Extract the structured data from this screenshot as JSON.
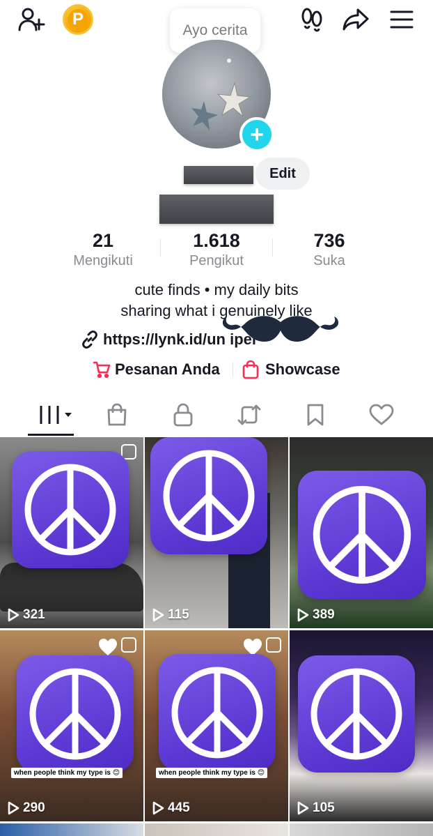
{
  "header": {
    "coin_letter": "P",
    "story_bubble": "Ayo cerita"
  },
  "profile": {
    "edit_label": "Edit"
  },
  "stats": [
    {
      "value": "21",
      "label": "Mengikuti"
    },
    {
      "value": "1.618",
      "label": "Pengikut"
    },
    {
      "value": "736",
      "label": "Suka"
    }
  ],
  "bio": {
    "line1": "cute finds • my daily bits",
    "line2": "sharing what i genuinely like",
    "link": "https://lynk.id/un          iper"
  },
  "shop": {
    "orders_label": "Pesanan Anda",
    "showcase_label": "Showcase",
    "accent": "#fe2c55"
  },
  "tabs": [
    "videos-icon",
    "shop-bag-icon",
    "lock-icon",
    "repost-icon",
    "bookmark-icon",
    "heart-icon"
  ],
  "videos": [
    {
      "views": "321"
    },
    {
      "views": "115"
    },
    {
      "views": "389"
    },
    {
      "views": "290",
      "caption": "when people think my type is 😊"
    },
    {
      "views": "445",
      "caption": "when people think my type is 😊"
    },
    {
      "views": "105"
    }
  ],
  "colors": {
    "peace_tile": "#5b37d2",
    "plus_badge": "#20d5ec",
    "coin": "#f6a400"
  }
}
